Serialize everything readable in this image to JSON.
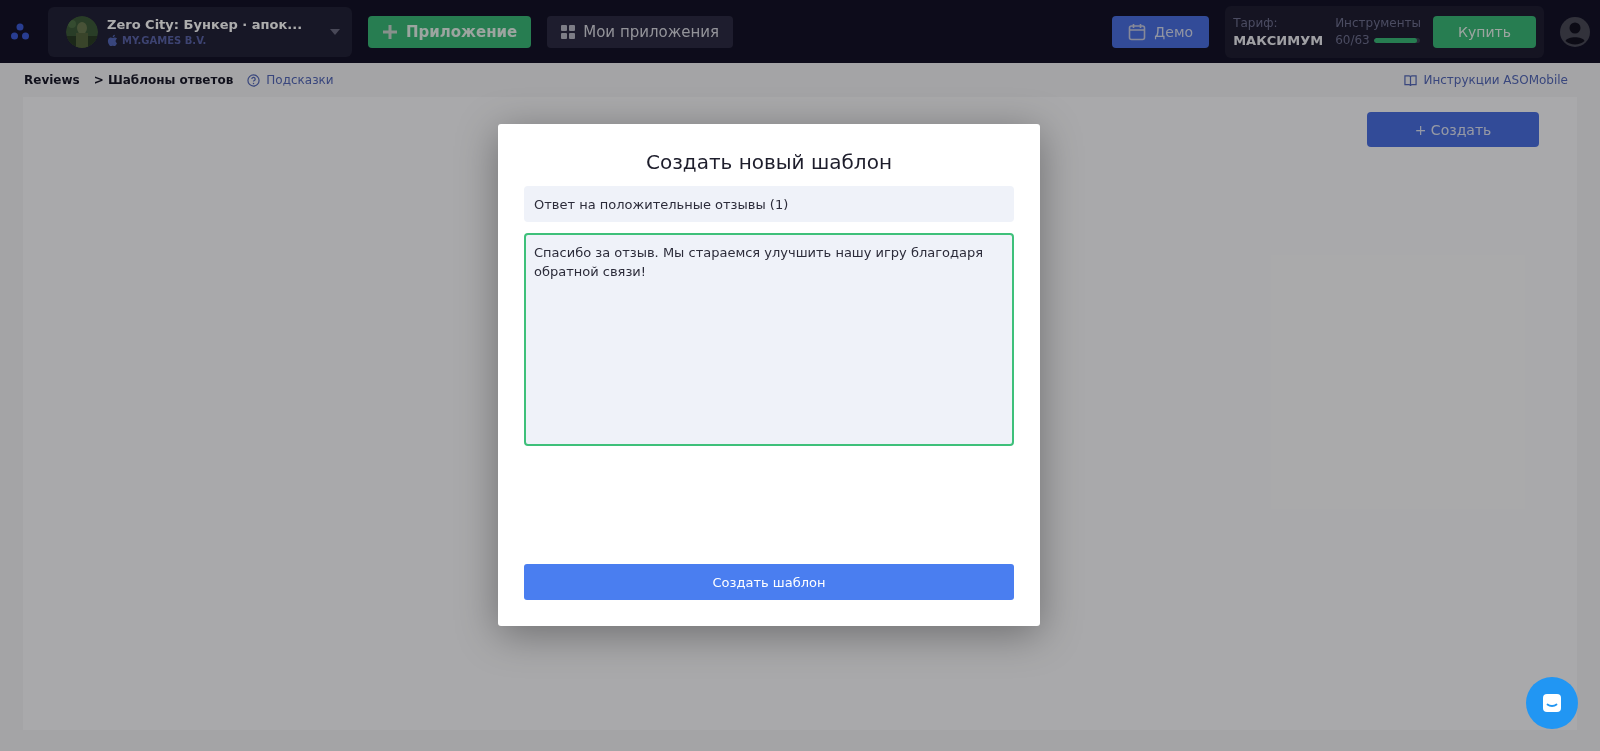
{
  "topbar": {
    "app": {
      "title": "Zero City: Бункер · апок...",
      "publisher": "MY.GAMES B.V."
    },
    "add_app_button": "Приложение",
    "my_apps_button": "Мои приложения",
    "demo_button": "Демо",
    "plan": {
      "label": "Тариф:",
      "name": "МАКСИМУМ",
      "tools_label": "Инструменты",
      "tools_count": "60/63",
      "level": 0.95
    },
    "buy_button": "Купить"
  },
  "breadcrumb": [
    {
      "label": "Reviews"
    },
    {
      "label": "> Шаблоны ответов"
    }
  ],
  "hints_link": "Подсказки",
  "instructions_link": "Инструкции ASOMobile",
  "create_button": "+ Создать",
  "modal": {
    "title": "Создать новый шаблон",
    "name_value": "Ответ на положительные отзывы (1)",
    "text_value": "Спасибо за отзыв. Мы стараемся улучшить нашу игру благодаря обратной связи!",
    "submit_button": "Создать шаблон"
  }
}
